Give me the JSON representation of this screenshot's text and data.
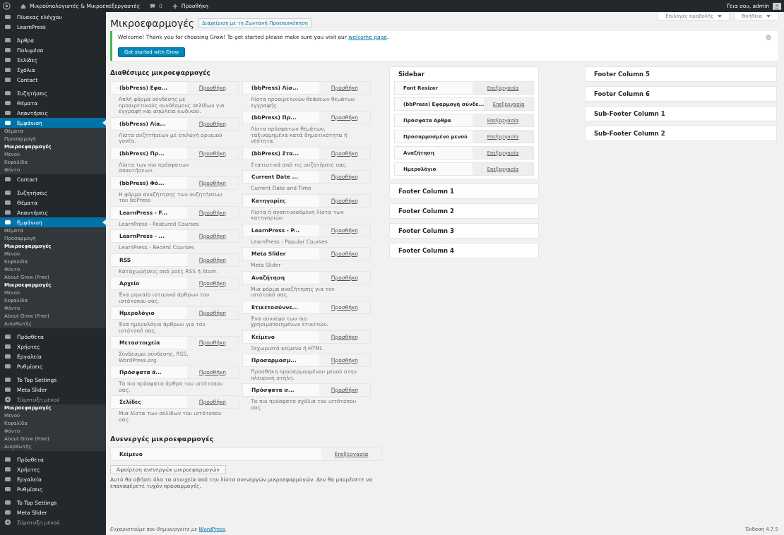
{
  "admin_bar": {
    "site": "Μικροϋπολογιστές & Μικροεπεξεργαστές",
    "comments": "0",
    "new": "Προσθήκη",
    "greeting": "Γεια σου, admin"
  },
  "sidebar": {
    "items": [
      {
        "kind": "menu",
        "label": "Πίνακας ελέγχου",
        "selected": false
      },
      {
        "kind": "menu",
        "label": "LearnPress",
        "selected": false
      },
      {
        "kind": "separator"
      },
      {
        "kind": "menu",
        "label": "Άρθρα",
        "selected": false
      },
      {
        "kind": "menu",
        "label": "Πολυμέσα",
        "selected": false
      },
      {
        "kind": "menu",
        "label": "Σελίδες",
        "selected": false
      },
      {
        "kind": "menu",
        "label": "Σχόλια",
        "selected": false
      },
      {
        "kind": "menu",
        "label": "Contact",
        "selected": false
      },
      {
        "kind": "separator"
      },
      {
        "kind": "menu",
        "label": "Συζητήσεις",
        "selected": false
      },
      {
        "kind": "menu",
        "label": "Θέματα",
        "selected": false
      },
      {
        "kind": "menu",
        "label": "Απαντήσεις",
        "selected": false
      },
      {
        "kind": "menu",
        "label": "Εμφάνιση",
        "selected": true
      },
      {
        "kind": "sub",
        "label": "Θέματα",
        "selected": false
      },
      {
        "kind": "sub",
        "label": "Προσαρμογή",
        "selected": false
      },
      {
        "kind": "sub",
        "label": "Μικροεφαρμογές",
        "selected": true
      },
      {
        "kind": "sub",
        "label": "Μενού",
        "selected": false
      },
      {
        "kind": "sub",
        "label": "Κεφαλίδα",
        "selected": false
      },
      {
        "kind": "sub",
        "label": "Φόντο",
        "selected": false
      },
      {
        "kind": "menu",
        "label": "Contact",
        "selected": false
      },
      {
        "kind": "separator"
      },
      {
        "kind": "menu",
        "label": "Συζητήσεις",
        "selected": false
      },
      {
        "kind": "menu",
        "label": "Θέματα",
        "selected": false
      },
      {
        "kind": "menu",
        "label": "Απαντήσεις",
        "selected": false
      },
      {
        "kind": "menu",
        "label": "Εμφάνιση",
        "selected": true
      },
      {
        "kind": "sub",
        "label": "Θέματα",
        "selected": false
      },
      {
        "kind": "sub",
        "label": "Προσαρμογή",
        "selected": false
      },
      {
        "kind": "sub",
        "label": "Μικροεφαρμογές",
        "selected": true
      },
      {
        "kind": "sub",
        "label": "Μενού",
        "selected": false
      },
      {
        "kind": "sub",
        "label": "Κεφαλίδα",
        "selected": false
      },
      {
        "kind": "sub",
        "label": "Φόντο",
        "selected": false
      },
      {
        "kind": "sub",
        "label": "About Grow (Free)",
        "selected": false
      },
      {
        "kind": "sub",
        "label": "Μικροεφαρμογές",
        "selected": true
      },
      {
        "kind": "sub",
        "label": "Μενού",
        "selected": false
      },
      {
        "kind": "sub",
        "label": "Κεφαλίδα",
        "selected": false
      },
      {
        "kind": "sub",
        "label": "Φόντο",
        "selected": false
      },
      {
        "kind": "sub",
        "label": "About Grow (Free)",
        "selected": false
      },
      {
        "kind": "sub",
        "label": "Διορθωτής",
        "selected": false
      },
      {
        "kind": "separator"
      },
      {
        "kind": "menu",
        "label": "Πρόσθετα",
        "selected": false
      },
      {
        "kind": "menu",
        "label": "Χρήστες",
        "selected": false
      },
      {
        "kind": "menu",
        "label": "Εργαλεία",
        "selected": false
      },
      {
        "kind": "menu",
        "label": "Ρυθμίσεις",
        "selected": false
      },
      {
        "kind": "separator"
      },
      {
        "kind": "menu",
        "label": "To Top Settings",
        "selected": false
      },
      {
        "kind": "menu",
        "label": "Meta Slider",
        "selected": false
      },
      {
        "kind": "collapse",
        "label": "Σύμπτυξη μενού"
      },
      {
        "kind": "sub",
        "label": "Μικροεφαρμογές",
        "selected": true
      },
      {
        "kind": "sub",
        "label": "Μενού",
        "selected": false
      },
      {
        "kind": "sub",
        "label": "Κεφαλίδα",
        "selected": false
      },
      {
        "kind": "sub",
        "label": "Φόντο",
        "selected": false
      },
      {
        "kind": "sub",
        "label": "About Grow (Free)",
        "selected": false
      },
      {
        "kind": "sub",
        "label": "Διορθωτής",
        "selected": false
      },
      {
        "kind": "separator"
      },
      {
        "kind": "menu",
        "label": "Πρόσθετα",
        "selected": false
      },
      {
        "kind": "menu",
        "label": "Χρήστες",
        "selected": false
      },
      {
        "kind": "menu",
        "label": "Εργαλεία",
        "selected": false
      },
      {
        "kind": "menu",
        "label": "Ρυθμίσεις",
        "selected": false
      },
      {
        "kind": "separator"
      },
      {
        "kind": "menu",
        "label": "To Top Settings",
        "selected": false
      },
      {
        "kind": "menu",
        "label": "Meta Slider",
        "selected": false
      },
      {
        "kind": "collapse",
        "label": "Σύμπτυξη μενού"
      }
    ]
  },
  "screen_tabs": [
    "Επιλογές προβολής",
    "Βοήθεια"
  ],
  "page_title": "Μικροεφαρμογές",
  "live_preview_button": "Διαχείριση με τη Ζωντανή Προεπισκόπηση",
  "notice": {
    "text": "Welcome! Thank you for choosing Grow! To get started please make sure you visit our",
    "link": "welcome page",
    "end": ".",
    "button": "Get started with Grow"
  },
  "available": {
    "title": "Διαθέσιμες μικροεφαρμογές",
    "left": [
      {
        "name": "(bbPress) Εφα...",
        "action": "Προσθήκη",
        "description": "Απλή φόρμα σύνδεσης με προαιρετικούς συνδέσμους σελίδων για εγγραφή και απώλεια κωδικού."
      },
      {
        "name": "(bbPress) Λία...",
        "action": "Προσθήκη",
        "description": "Λίστα συζητήσεων με επιλογή ορισμού γονέα."
      },
      {
        "name": "(bbPress) Πρ...",
        "action": "Προσθήκη",
        "description": "Λίστα των πιο πρόσφατων απαντήσεων."
      },
      {
        "name": "(bbPress) Φό...",
        "action": "Προσθήκη",
        "description": "Η φόρμα αναζήτησης των συζητήσεων του bbPress"
      },
      {
        "name": "LearnPress - F...",
        "action": "Προσθήκη",
        "description": "LearnPress - Featured Courses"
      },
      {
        "name": "LearnPress - ...",
        "action": "Προσθήκη",
        "description": "LearnPress - Recent Courses"
      },
      {
        "name": "RSS",
        "action": "Προσθήκη",
        "description": "Καταχωρήσεις από ροές RSS ή Atom."
      },
      {
        "name": "Αρχείο",
        "action": "Προσθήκη",
        "description": "Ένα μηνιαίο ιστορικό άρθρων του ιστότοπου σας."
      },
      {
        "name": "Ημερολόγιο",
        "action": "Προσθήκη",
        "description": "Ένα ημερολόγιο άρθρων για τον ιστότοπό σας."
      },
      {
        "name": "Μεταστοιχεία",
        "action": "Προσθήκη",
        "description": "Σύνδεσμοι σύνδεσης, RSS, WordPress.org"
      },
      {
        "name": "Πρόσφατα ά...",
        "action": "Προσθήκη",
        "description": "Τα πιο πρόσφατα άρθρα του ιστότοπου σας."
      },
      {
        "name": "Σελίδες",
        "action": "Προσθήκη",
        "description": "Μια λίστα των σελίδων του ιστότοπου σας."
      }
    ],
    "right": [
      {
        "name": "(bbPress) Λίσ...",
        "action": "Προσθήκη",
        "description": "Λίστα προαιρετικών θεάσεων θεμάτων εγγραφής."
      },
      {
        "name": "(bbPress) Πρ...",
        "action": "Προσθήκη",
        "description": "Λίστα πρόσφατων θεμάτων, ταξινομημένα κατά δημοτικότητα ή νεότητα."
      },
      {
        "name": "(bbPress) Στα...",
        "action": "Προσθήκη",
        "description": "Στατιστικά από τις συζητήσεις σας."
      },
      {
        "name": "Current Date ...",
        "action": "Προσθήκη",
        "description": "Current Date and Time"
      },
      {
        "name": "Κατηγορίες",
        "action": "Προσθήκη",
        "description": "Λίστα ή αναπτυσσόμενη λίστα των κατηγοριών"
      },
      {
        "name": "LearnPress - P...",
        "action": "Προσθήκη",
        "description": "LearnPress - Popular Courses"
      },
      {
        "name": "Meta Slider",
        "action": "Προσθήκη",
        "description": "Meta Slider"
      },
      {
        "name": "Αναζήτηση",
        "action": "Προσθήκη",
        "description": "Μια φόρμα αναζήτησης για τον ιστότοπό σας."
      },
      {
        "name": "Ετικετοσύννε...",
        "action": "Προσθήκη",
        "description": "Ένα σύννεφο των πιο χρησιμοποιημένων ετικετών."
      },
      {
        "name": "Κείμενο",
        "action": "Προσθήκη",
        "description": "Ξεχωριστό κείμενο ή HTML"
      },
      {
        "name": "Προσαρμοσμ...",
        "action": "Προσθήκη",
        "description": "Προσθήκη προσαρμοσμένου μενού στην πλευρική στήλη."
      },
      {
        "name": "Πρόσφατα σ...",
        "action": "Προσθήκη",
        "description": "Τα πιο πρόσφατα σχόλια του ιστότοπου σας."
      }
    ]
  },
  "inactive": {
    "title": "Ανενεργές μικροεφαρμογές",
    "widgets": [
      {
        "name": "Κείμενο",
        "action": "Επεξεργασία"
      }
    ],
    "clear_button": "Αφαίρεση ανενεργών μικροεφαρμογών",
    "note": "Αυτό θα σβήσει όλα τα στοιχεία από την λίστα ανενεργών μικροεφαρμογών. Δεν θα μπορέσετε να επαναφέρετε τυχόν προσαρμογές."
  },
  "areas": {
    "columns": [
      [
        {
          "title": "Sidebar",
          "expanded": true,
          "widgets": [
            {
              "name": "Font Resizer",
              "action": "Επεξεργασία"
            },
            {
              "name": "(bbPress) Εφαρμογή σύνδε...",
              "action": "Επεξεργασία"
            },
            {
              "name": "Πρόσφατα άρθρα",
              "action": "Επεξεργασία"
            },
            {
              "name": "Προσαρμοσμένο μενού",
              "action": "Επεξεργασία"
            },
            {
              "name": "Αναζήτηση",
              "action": "Επεξεργασία"
            },
            {
              "name": "Ημερολόγιο",
              "action": "Επεξεργασία"
            }
          ]
        },
        {
          "title": "Footer Column 1",
          "expanded": false
        },
        {
          "title": "Footer Column 2",
          "expanded": false
        },
        {
          "title": "Footer Column 3",
          "expanded": false
        },
        {
          "title": "Footer Column 4",
          "expanded": false
        }
      ],
      [
        {
          "title": "Footer Column 5",
          "expanded": false
        },
        {
          "title": "Footer Column 6",
          "expanded": false
        },
        {
          "title": "Sub-Footer Column 1",
          "expanded": false
        },
        {
          "title": "Sub-Footer Column 2",
          "expanded": false
        }
      ]
    ]
  },
  "footer": {
    "text": "Ευχαριστούμε που δημιουργείτε με",
    "link": "WordPress",
    "end": ".",
    "version": "Έκδοση 4.7.5"
  }
}
